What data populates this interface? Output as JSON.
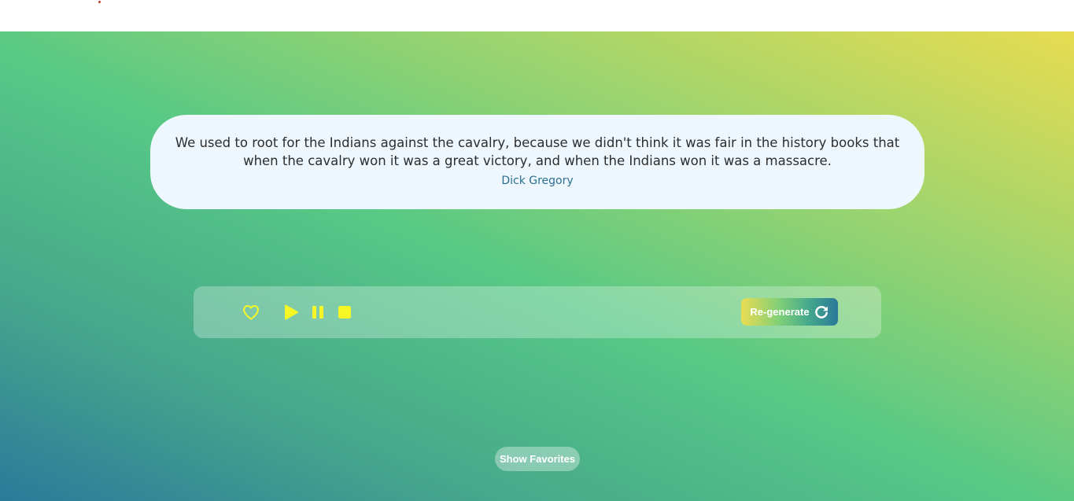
{
  "quote": {
    "text": "We used to root for the Indians against the cavalry, because we didn't think it was fair in the history books that when the cavalry won it was a great victory, and when the Indians won it was a massacre.",
    "author": "Dick Gregory"
  },
  "controls": {
    "favorite_icon": "heart-outline-icon",
    "play_icon": "play-icon",
    "pause_icon": "pause-icon",
    "stop_icon": "stop-icon",
    "icon_color": "#f7f726",
    "regenerate_label": "Re-generate",
    "regenerate_icon": "refresh-icon"
  },
  "footer": {
    "show_favorites_label": "Show Favorites"
  },
  "colors": {
    "gradient_start": "#2a7a9a",
    "gradient_mid": "#58c985",
    "gradient_end": "#e8dc50",
    "card_background": "#eef7fd",
    "quote_text": "#2e2e2e",
    "author_text": "#2a6f8e"
  }
}
